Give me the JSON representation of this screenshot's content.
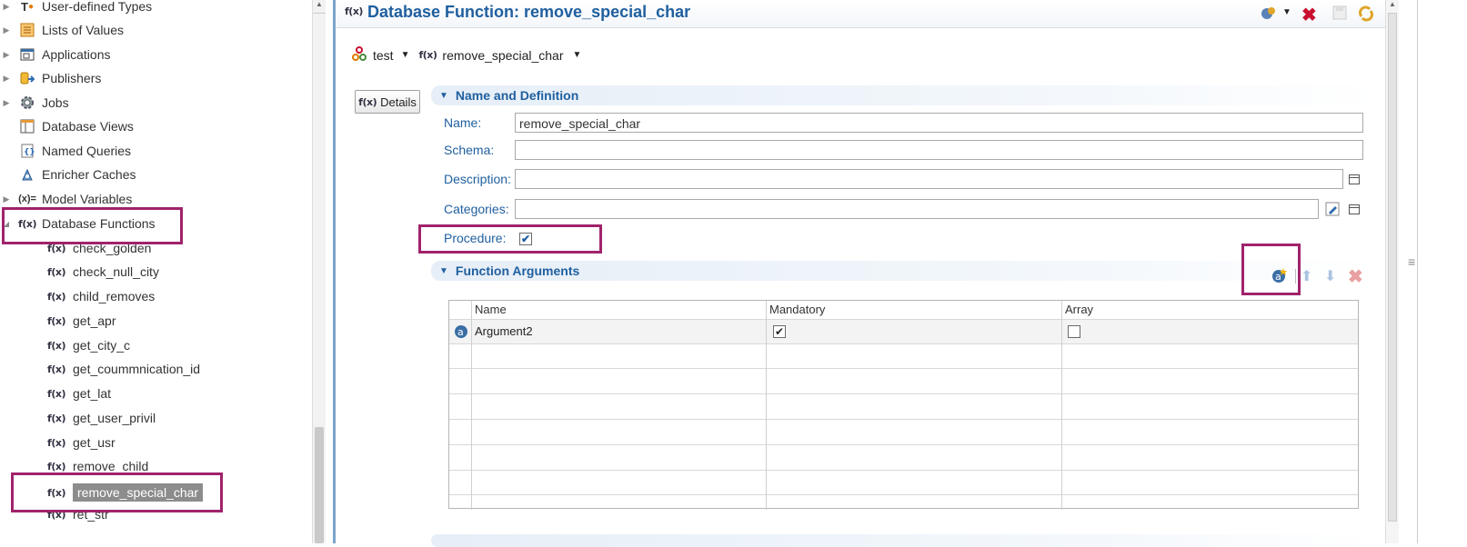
{
  "tree": {
    "items": [
      {
        "label": "User-defined Types",
        "icon": "types-icon",
        "expandable": true
      },
      {
        "label": "Lists of Values",
        "icon": "list-icon",
        "expandable": true
      },
      {
        "label": "Applications",
        "icon": "applications-icon",
        "expandable": true
      },
      {
        "label": "Publishers",
        "icon": "publishers-icon",
        "expandable": true
      },
      {
        "label": "Jobs",
        "icon": "gear-icon",
        "expandable": true
      },
      {
        "label": "Database Views",
        "icon": "views-icon",
        "expandable": false
      },
      {
        "label": "Named Queries",
        "icon": "query-icon",
        "expandable": false
      },
      {
        "label": "Enricher Caches",
        "icon": "cache-icon",
        "expandable": false
      },
      {
        "label": "Model Variables",
        "icon": "variable-icon",
        "expandable": true
      },
      {
        "label": "Database Functions",
        "icon": "function-icon",
        "expandable": true,
        "expanded": true
      }
    ],
    "functions": [
      "check_golden",
      "check_null_city",
      "child_removes",
      "get_apr",
      "get_city_c",
      "get_coummnication_id",
      "get_lat",
      "get_user_privil",
      "get_usr",
      "remove_child",
      "remove_special_char",
      "ret_str"
    ],
    "selected": "remove_special_char"
  },
  "editor": {
    "title": "Database Function: remove_special_char",
    "breadcrumb": {
      "model": "test",
      "function": "remove_special_char"
    },
    "details_label": "Details",
    "name_section": {
      "title": "Name and Definition",
      "name_label": "Name:",
      "name_value": "remove_special_char",
      "schema_label": "Schema:",
      "schema_value": "",
      "description_label": "Description:",
      "description_value": "",
      "categories_label": "Categories:",
      "categories_value": "",
      "procedure_label": "Procedure:",
      "procedure_checked": true
    },
    "args_section": {
      "title": "Function Arguments",
      "columns": [
        "Name",
        "Mandatory",
        "Array"
      ],
      "rows": [
        {
          "name": "Argument2",
          "mandatory": true,
          "array": false
        }
      ]
    }
  },
  "colors": {
    "accent": "#1f5f9f",
    "highlight": "#a0236b",
    "selection": "#8c8c8c"
  },
  "fx_glyph": "f(x)"
}
